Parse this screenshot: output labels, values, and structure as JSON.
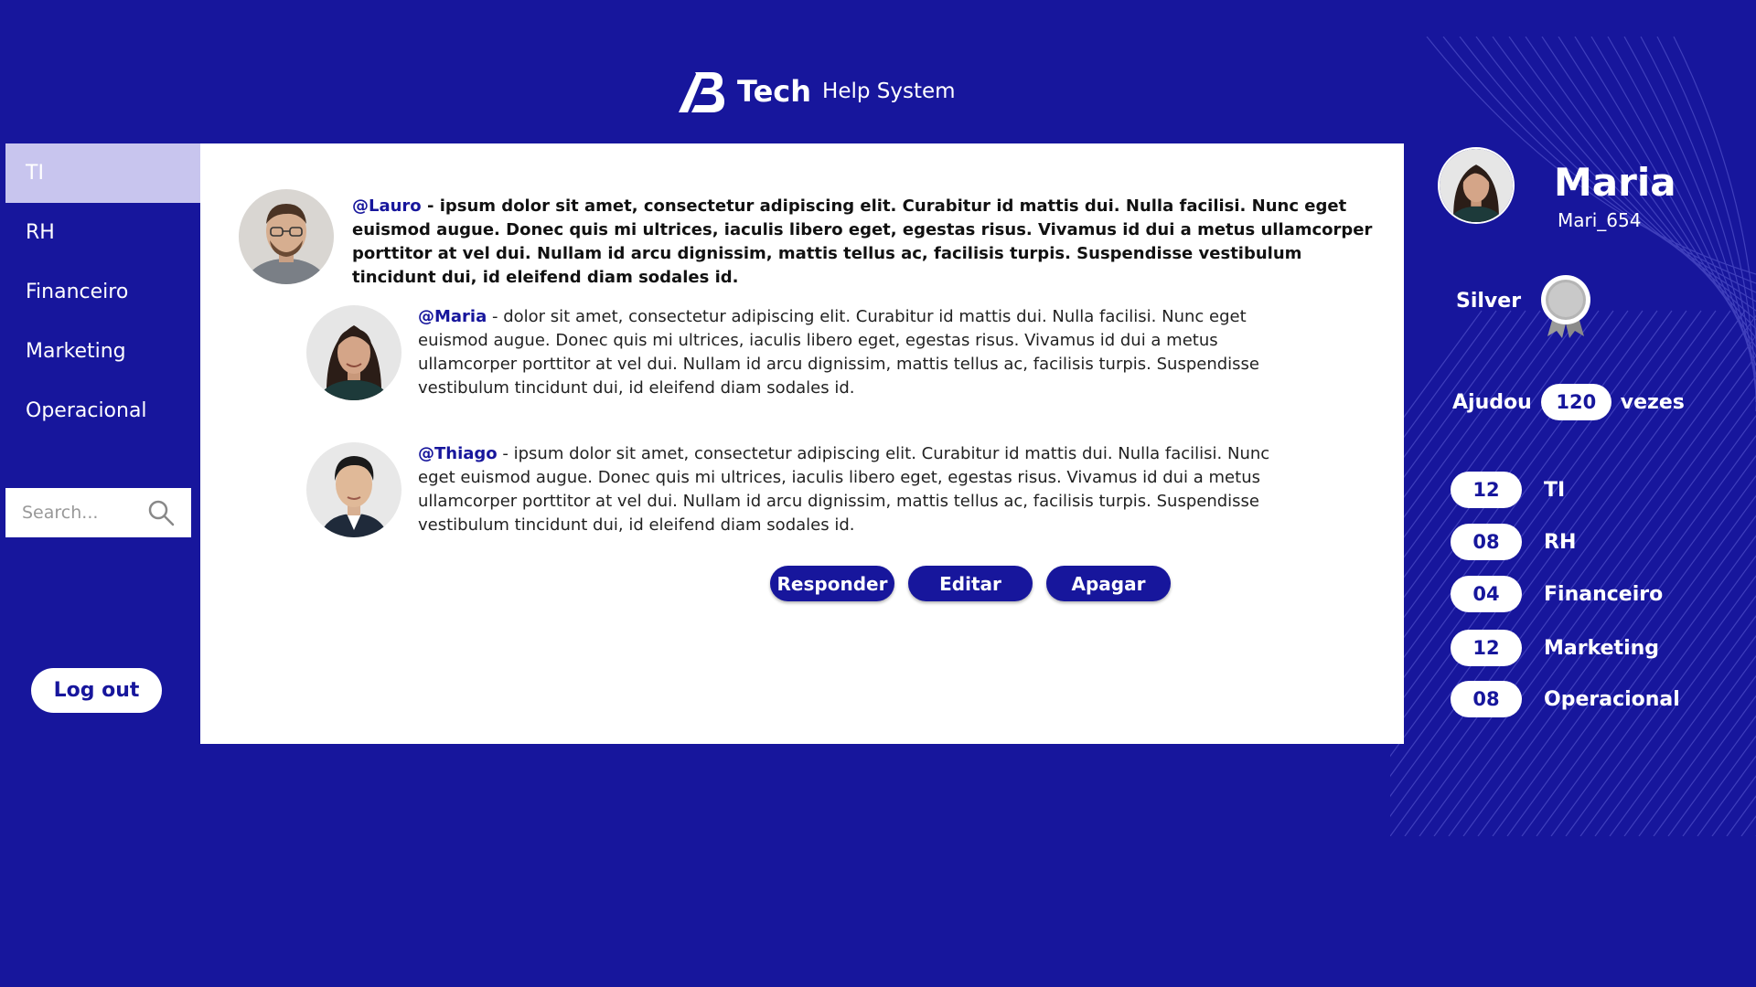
{
  "header": {
    "brand": "Tech",
    "subtitle": "Help System"
  },
  "sidebar": {
    "items": [
      {
        "label": "TI",
        "active": true
      },
      {
        "label": "RH"
      },
      {
        "label": "Financeiro"
      },
      {
        "label": "Marketing"
      },
      {
        "label": "Operacional"
      }
    ],
    "search_placeholder": "Search...",
    "logout_label": "Log out"
  },
  "thread": {
    "main": {
      "handle": "@Lauro",
      "separator": " - ",
      "text": "ipsum dolor sit amet, consectetur adipiscing elit. Curabitur id mattis dui. Nulla facilisi. Nunc eget euismod augue. Donec quis mi ultrices, iaculis libero eget, egestas risus. Vivamus id dui a metus ullamcorper porttitor at vel dui. Nullam id arcu dignissim, mattis tellus ac, facilisis turpis. Suspendisse vestibulum tincidunt dui, id eleifend diam sodales id."
    },
    "replies": [
      {
        "handle": "@Maria",
        "separator": " - ",
        "text": "dolor sit amet, consectetur adipiscing elit. Curabitur id mattis dui. Nulla facilisi. Nunc eget euismod augue. Donec quis mi ultrices, iaculis libero eget, egestas risus. Vivamus id dui a metus ullamcorper porttitor at vel dui. Nullam id arcu dignissim, mattis tellus ac, facilisis turpis. Suspendisse vestibulum tincidunt dui, id eleifend diam sodales id."
      },
      {
        "handle": "@Thiago",
        "separator": " -  ",
        "text": "ipsum dolor sit amet, consectetur adipiscing elit. Curabitur id mattis dui. Nulla facilisi. Nunc eget euismod augue. Donec quis mi ultrices, iaculis libero eget, egestas risus. Vivamus id dui a metus ullamcorper porttitor at vel dui. Nullam id arcu dignissim, mattis tellus ac, facilisis turpis. Suspendisse vestibulum tincidunt dui, id eleifend diam sodales id."
      }
    ],
    "actions": {
      "reply": "Responder",
      "edit": "Editar",
      "delete": "Apagar"
    }
  },
  "profile": {
    "name": "Maria",
    "username": "Mari_654",
    "rank": "Silver",
    "helped_prefix": "Ajudou",
    "helped_count": "120",
    "helped_suffix": "vezes",
    "stats": [
      {
        "count": "12",
        "label": "TI"
      },
      {
        "count": "08",
        "label": "RH"
      },
      {
        "count": "04",
        "label": "Financeiro"
      },
      {
        "count": "12",
        "label": "Marketing"
      },
      {
        "count": "08",
        "label": "Operacional"
      }
    ]
  },
  "colors": {
    "background": "#17169c",
    "accent": "#17169c",
    "active_nav": "#c8c5ee"
  },
  "icons": [
    "logo-mark",
    "search-icon",
    "silver-medal-icon"
  ]
}
